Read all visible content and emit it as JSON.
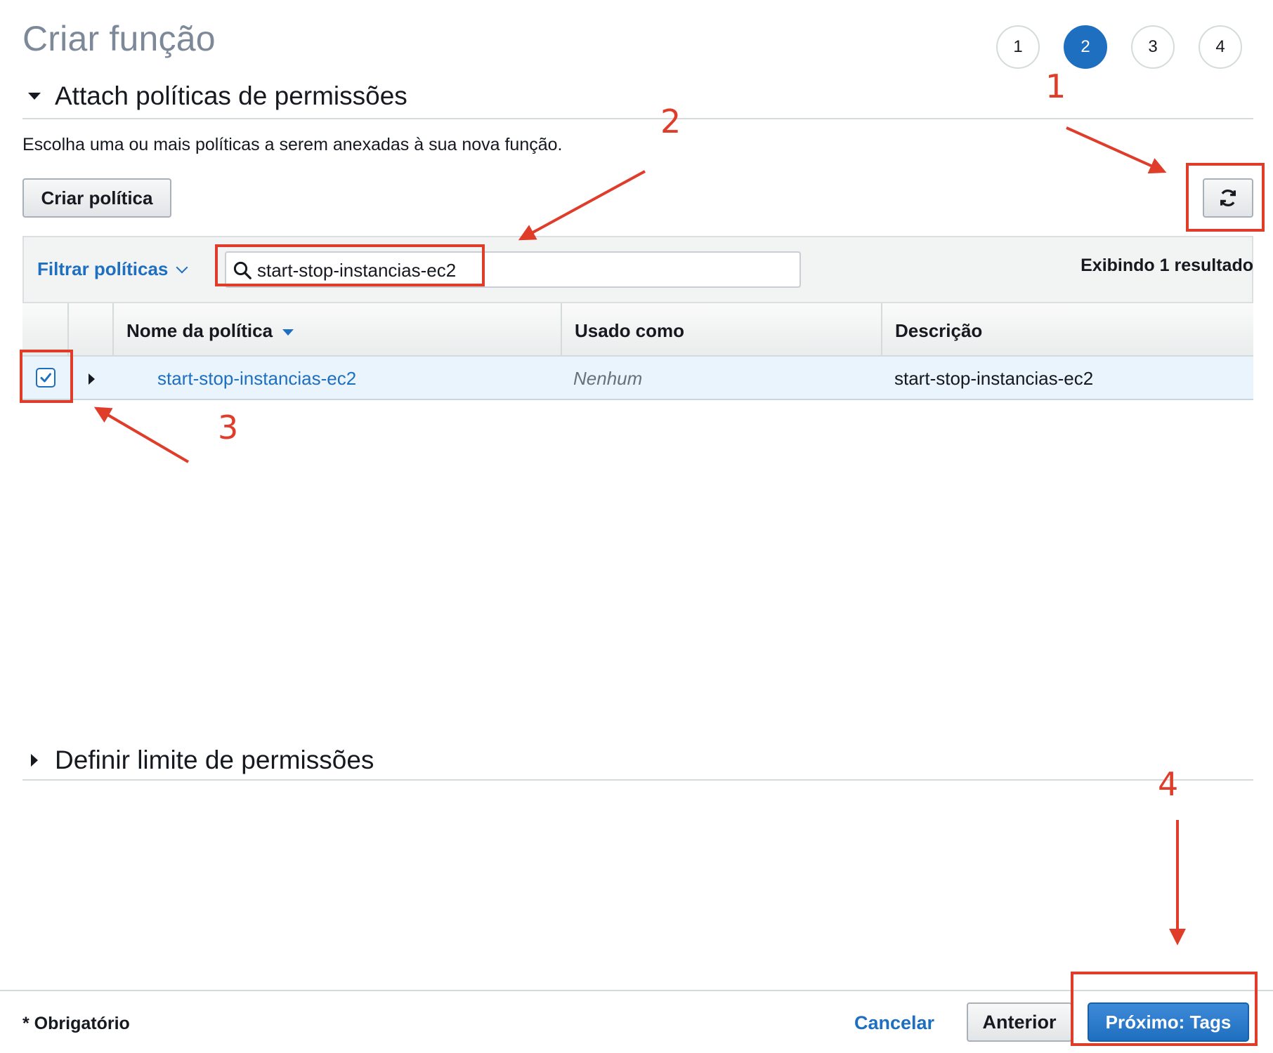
{
  "page": {
    "title": "Criar função"
  },
  "stepper": {
    "steps": [
      "1",
      "2",
      "3",
      "4"
    ],
    "active_index": 1
  },
  "section_attach": {
    "title": "Attach políticas de permissões",
    "description": "Escolha uma ou mais políticas a serem anexadas à sua nova função."
  },
  "toolbar": {
    "create_policy_label": "Criar política",
    "refresh_icon": "refresh-icon"
  },
  "filter": {
    "filter_label": "Filtrar políticas",
    "search_value": "start-stop-instancias-ec2",
    "result_count": "Exibindo 1 resultado"
  },
  "table": {
    "headers": {
      "name": "Nome da política",
      "used_as": "Usado como",
      "description": "Descrição"
    },
    "rows": [
      {
        "name": "start-stop-instancias-ec2",
        "used_as": "Nenhum",
        "description": "start-stop-instancias-ec2",
        "checked": true
      }
    ]
  },
  "section_boundary": {
    "title": "Definir limite de permissões"
  },
  "footer": {
    "required_note": "* Obrigatório",
    "cancel_label": "Cancelar",
    "previous_label": "Anterior",
    "next_label": "Próximo: Tags"
  },
  "annotations": {
    "labels": [
      "1",
      "2",
      "3",
      "4"
    ],
    "color": "#e03c2a"
  },
  "colors": {
    "accent": "#1f6fc0",
    "annotation": "#e03c2a"
  }
}
